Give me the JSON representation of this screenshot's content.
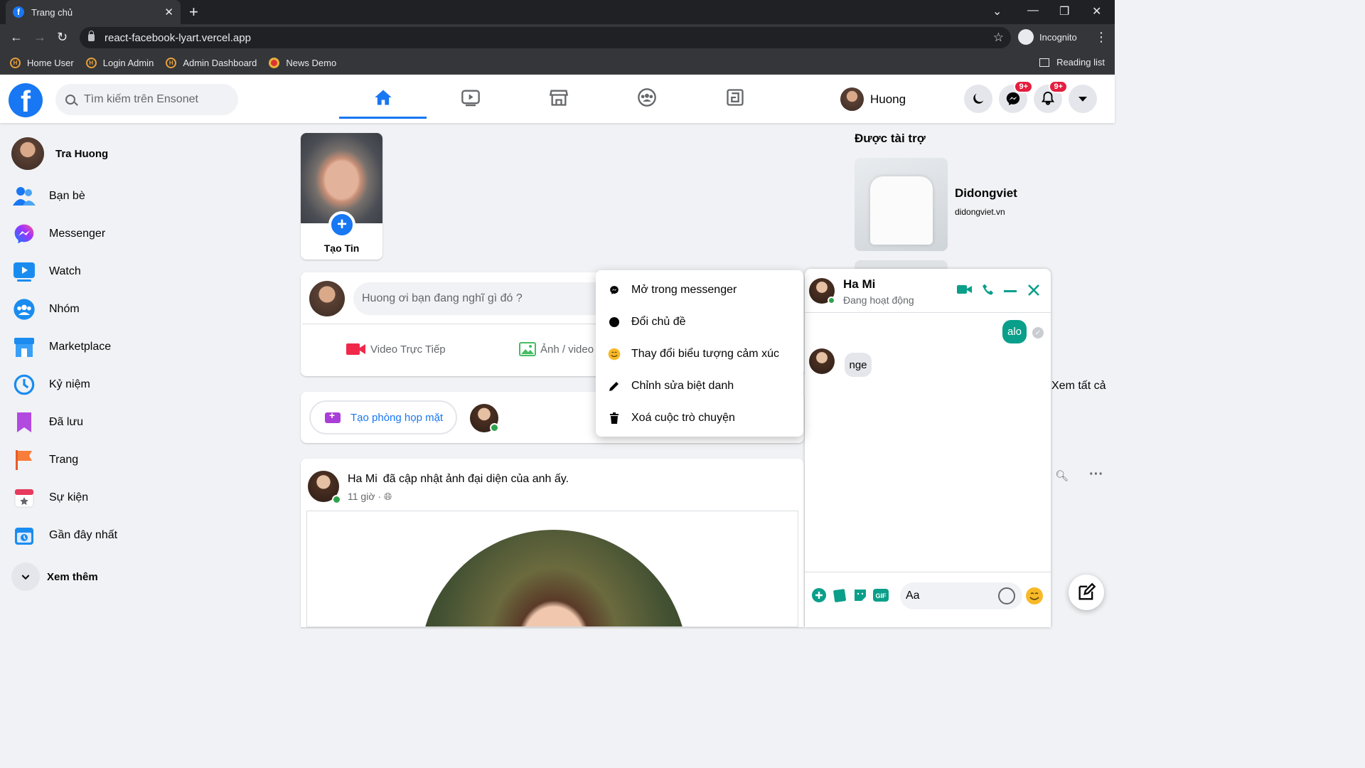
{
  "browser": {
    "tab_title": "Trang chủ",
    "url": "react-facebook-lyart.vercel.app",
    "profile": "Incognito",
    "bookmarks": [
      {
        "label": "Home User"
      },
      {
        "label": "Login Admin"
      },
      {
        "label": "Admin Dashboard"
      },
      {
        "label": "News Demo"
      }
    ],
    "reading_list": "Reading list"
  },
  "header": {
    "search_placeholder": "Tìm kiếm trên Ensonet",
    "user_name": "Huong",
    "messenger_badge": "9+",
    "notifications_badge": "9+",
    "accent": "#1877f2"
  },
  "sidebar": {
    "user": "Tra Huong",
    "items": [
      {
        "label": "Bạn bè",
        "icon": "friends-icon"
      },
      {
        "label": "Messenger",
        "icon": "messenger-icon"
      },
      {
        "label": "Watch",
        "icon": "watch-icon"
      },
      {
        "label": "Nhóm",
        "icon": "groups-icon"
      },
      {
        "label": "Marketplace",
        "icon": "marketplace-icon"
      },
      {
        "label": "Kỷ niệm",
        "icon": "memories-icon"
      },
      {
        "label": "Đã lưu",
        "icon": "saved-icon"
      },
      {
        "label": "Trang",
        "icon": "pages-icon"
      },
      {
        "label": "Sự kiện",
        "icon": "events-icon"
      },
      {
        "label": "Gần đây nhất",
        "icon": "recent-icon"
      }
    ],
    "see_more": "Xem thêm"
  },
  "story": {
    "label": "Tạo Tin"
  },
  "composer": {
    "placeholder": "Huong ơi bạn đang nghĩ gì đó ?",
    "live_video": "Video Trực Tiếp",
    "photo_video": "Ảnh / video"
  },
  "rooms": {
    "create": "Tạo phòng họp mặt"
  },
  "post": {
    "author": "Ha Mi",
    "action": "đã cập nhật ảnh đại diện của anh ấy.",
    "time": "11 giờ ·"
  },
  "sponsored": {
    "title": "Được tài trợ",
    "name": "Didongviet",
    "site": "didongviet.vn"
  },
  "contacts": {
    "see_all": "Xem tất cả"
  },
  "chat": {
    "name": "Ha Mi",
    "status": "Đang hoạt động",
    "messages": [
      {
        "from": "me",
        "text": "alo"
      },
      {
        "from": "them",
        "text": "nge"
      }
    ],
    "input_placeholder": "Aa",
    "accent": "#0a9f8a"
  },
  "context_menu": {
    "items": [
      {
        "label": "Mở trong messenger",
        "icon": "messenger-icon"
      },
      {
        "label": "Đổi chủ đề",
        "icon": "theme-dot-icon"
      },
      {
        "label": "Thay đổi biểu tượng cảm xúc",
        "icon": "emoji-icon"
      },
      {
        "label": "Chỉnh sửa biệt danh",
        "icon": "pencil-icon"
      },
      {
        "label": "Xoá cuộc trò chuyện",
        "icon": "trash-icon"
      }
    ]
  }
}
